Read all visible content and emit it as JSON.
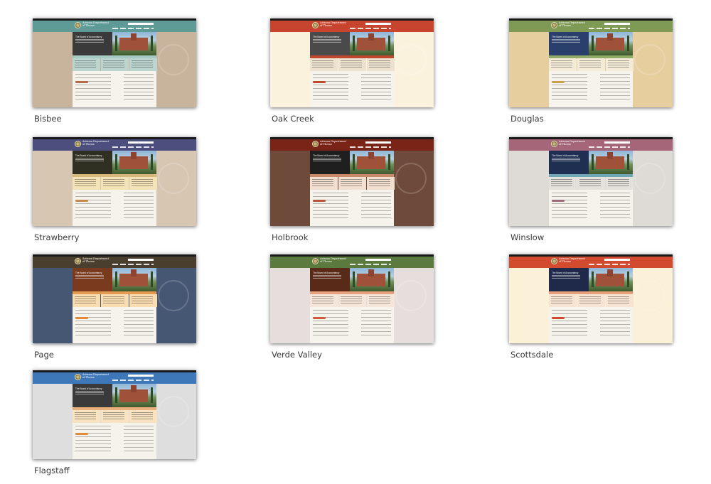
{
  "themes": [
    {
      "name": "Bisbee",
      "header": "#5e9a96",
      "bg": "#c8b39c",
      "hero": "#3a3a3a",
      "tab": "#a7c9c2",
      "cols": [
        "#bcd6cf",
        "#bcd6cf",
        "#bcd6cf"
      ],
      "accent": "#b56a4a"
    },
    {
      "name": "Oak Creek",
      "header": "#c7452e",
      "bg": "#fbf2de",
      "hero": "#4a4a4a",
      "tab": "#c2472e",
      "cols": [
        "#ece2cf",
        "#ece2cf",
        "#ece2cf"
      ],
      "accent": "#c2472e"
    },
    {
      "name": "Douglas",
      "header": "#7f9a55",
      "bg": "#e6ce9e",
      "hero": "#2a3f6b",
      "tab": "#8fab66",
      "cols": [
        "#f4ebd8",
        "#f4ebd8",
        "#f4ebd8"
      ],
      "accent": "#c7a24a"
    },
    {
      "name": "Strawberry",
      "header": "#4c4f7e",
      "bg": "#d6c6b2",
      "hero": "#2f2f22",
      "tab": "#d6b87a",
      "cols": [
        "#f5e3b8",
        "#f5e3b8",
        "#f5e3b8"
      ],
      "accent": "#c88a4a"
    },
    {
      "name": "Holbrook",
      "header": "#7a2418",
      "bg": "#6e4a3a",
      "hero": "#1f1f1f",
      "tab": "#c98a6a",
      "cols": [
        "#f3dfcf",
        "#f3dfcf",
        "#f3dfcf"
      ],
      "accent": "#b4563a"
    },
    {
      "name": "Winslow",
      "header": "#a5667a",
      "bg": "#dedad6",
      "hero": "#1f2f52",
      "tab": "#6fa7b5",
      "cols": [
        "#e4e0dc",
        "#e4e0dc",
        "#e4e0dc"
      ],
      "accent": "#9c6a7a"
    },
    {
      "name": "Page",
      "header": "#4a3f2e",
      "bg": "#465773",
      "hero": "#7a3a1e",
      "tab": "#e59a52",
      "cols": [
        "#f9dcb0",
        "#f9dcb0",
        "#f9dcb0"
      ],
      "accent": "#e08a3a"
    },
    {
      "name": "Verde Valley",
      "header": "#5a7a3e",
      "bg": "#e6dedd",
      "hero": "#5a2a18",
      "tab": "#e7a17d",
      "cols": [
        "#f6e6da",
        "#f6e6da",
        "#f6e6da"
      ],
      "accent": "#d35a3a"
    },
    {
      "name": "Scottsdale",
      "header": "#d24b2e",
      "bg": "#fbf0d8",
      "hero": "#1f2a4a",
      "tab": "#e8a07a",
      "cols": [
        "#f8e4d2",
        "#f8e4d2",
        "#f8e4d2"
      ],
      "accent": "#d24b2e"
    },
    {
      "name": "Flagstaff",
      "header": "#3f78b8",
      "bg": "#dedede",
      "hero": "#3a3a3a",
      "tab": "#e8b07a",
      "cols": [
        "#f8e2c0",
        "#f8e2c0",
        "#f8e2c0"
      ],
      "accent": "#e08a3a"
    }
  ]
}
